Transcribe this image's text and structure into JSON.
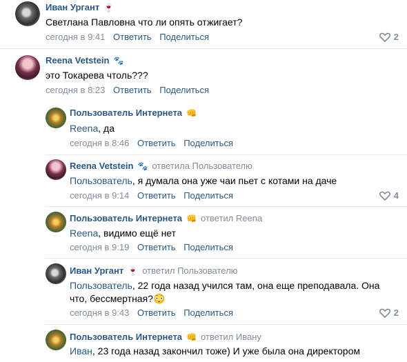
{
  "comments": [
    {
      "author": "Иван Ургант",
      "emoji": "🍷",
      "text": "Светлана Павловна что ли опять отжигает?",
      "time": "сегодня в 9:41",
      "reply": "Ответить",
      "share": "Поделиться",
      "likes": "2"
    },
    {
      "author": "Reena Vetstein",
      "emoji": "🐾",
      "text": "это Токарева чтоль???",
      "time": "сегодня в 8:23",
      "reply": "Ответить",
      "share": "Поделиться"
    },
    {
      "author": "Пользователь Интернета",
      "emoji": "👊",
      "mention": "Reena",
      "text": ", да",
      "time": "сегодня в 8:46",
      "reply": "Ответить",
      "share": "Поделиться"
    },
    {
      "author": "Reena Vetstein",
      "emoji": "🐾",
      "replied": "ответила Пользователю",
      "mention": "Пользователь",
      "text": ", я думала она уже чаи пьет с котами на даче",
      "time": "сегодня в 9:14",
      "reply": "Ответить",
      "share": "Поделиться",
      "likes": "4"
    },
    {
      "author": "Пользователь Интернета",
      "emoji": "👊",
      "replied": "ответил Reena",
      "mention": "Reena",
      "text": ", видимо ещё нет",
      "time": "сегодня в 9:19",
      "reply": "Ответить",
      "share": "Поделиться"
    },
    {
      "author": "Иван Ургант",
      "emoji": "🍷",
      "replied": "ответил Пользователю",
      "mention": "Пользователь",
      "text_line1": ", 22 года назад учился там, она еще преподавала. Она",
      "text_line2": "что, бессмертная?😳",
      "time": "сегодня в 9:43",
      "reply": "Ответить",
      "share": "Поделиться",
      "likes": "2"
    },
    {
      "author": "Пользователь Интернета",
      "emoji": "👊",
      "replied": "ответил Ивану",
      "mention": "Иван",
      "text": ", 23 года назад закончил тоже) И уже была она директором"
    }
  ]
}
